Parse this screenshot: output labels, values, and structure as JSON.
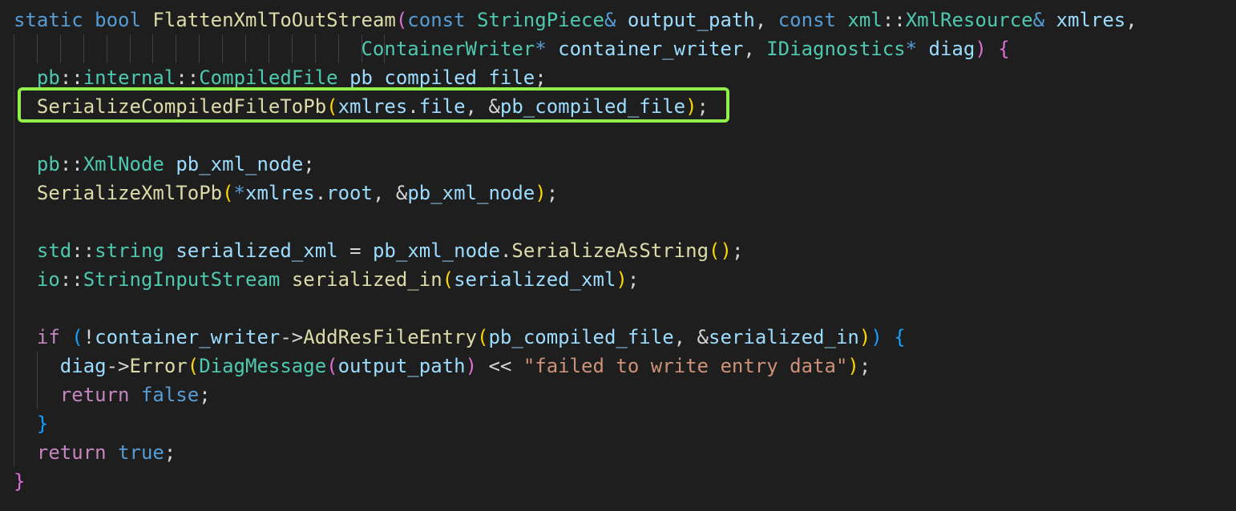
{
  "colors": {
    "background": "#1e1e1e",
    "keyword": "#569cd6",
    "function": "#dcdcaa",
    "type": "#4ec9b0",
    "variable": "#9cdcfe",
    "string": "#ce9178",
    "highlight_border": "#8ff04a"
  },
  "lines": [
    [
      {
        "t": "static",
        "c": "kw"
      },
      {
        "t": " ",
        "c": "op"
      },
      {
        "t": "bool",
        "c": "kw"
      },
      {
        "t": " ",
        "c": "op"
      },
      {
        "t": "FlattenXmlToOutStream",
        "c": "fn"
      },
      {
        "t": "(",
        "c": "b1"
      },
      {
        "t": "const",
        "c": "kw"
      },
      {
        "t": " ",
        "c": "op"
      },
      {
        "t": "StringPiece",
        "c": "ty"
      },
      {
        "t": "&",
        "c": "kw"
      },
      {
        "t": " ",
        "c": "op"
      },
      {
        "t": "output_path",
        "c": "var"
      },
      {
        "t": ", ",
        "c": "op"
      },
      {
        "t": "const",
        "c": "kw"
      },
      {
        "t": " ",
        "c": "op"
      },
      {
        "t": "xml",
        "c": "ty"
      },
      {
        "t": "::",
        "c": "op"
      },
      {
        "t": "XmlResource",
        "c": "ty"
      },
      {
        "t": "&",
        "c": "kw"
      },
      {
        "t": " ",
        "c": "op"
      },
      {
        "t": "xmlres",
        "c": "var"
      },
      {
        "t": ",",
        "c": "op"
      }
    ],
    [
      {
        "t": "                              ",
        "c": "op"
      },
      {
        "t": "ContainerWriter",
        "c": "ty"
      },
      {
        "t": "*",
        "c": "kw"
      },
      {
        "t": " ",
        "c": "op"
      },
      {
        "t": "container_writer",
        "c": "var"
      },
      {
        "t": ", ",
        "c": "op"
      },
      {
        "t": "IDiagnostics",
        "c": "ty"
      },
      {
        "t": "*",
        "c": "kw"
      },
      {
        "t": " ",
        "c": "op"
      },
      {
        "t": "diag",
        "c": "var"
      },
      {
        "t": ")",
        "c": "b1"
      },
      {
        "t": " ",
        "c": "op"
      },
      {
        "t": "{",
        "c": "b1"
      }
    ],
    [
      {
        "t": "  ",
        "c": "op"
      },
      {
        "t": "pb",
        "c": "ty"
      },
      {
        "t": "::",
        "c": "op"
      },
      {
        "t": "internal",
        "c": "ty"
      },
      {
        "t": "::",
        "c": "op"
      },
      {
        "t": "CompiledFile",
        "c": "ty"
      },
      {
        "t": " ",
        "c": "op"
      },
      {
        "t": "pb_compiled_file",
        "c": "var"
      },
      {
        "t": ";",
        "c": "op"
      }
    ],
    [
      {
        "t": "  ",
        "c": "op"
      },
      {
        "t": "SerializeCompiledFileToPb",
        "c": "fn"
      },
      {
        "t": "(",
        "c": "b2"
      },
      {
        "t": "xmlres",
        "c": "var"
      },
      {
        "t": ".",
        "c": "op"
      },
      {
        "t": "file",
        "c": "var"
      },
      {
        "t": ", &",
        "c": "op"
      },
      {
        "t": "pb_compiled_file",
        "c": "var"
      },
      {
        "t": ")",
        "c": "b2"
      },
      {
        "t": ";",
        "c": "op"
      }
    ],
    [],
    [
      {
        "t": "  ",
        "c": "op"
      },
      {
        "t": "pb",
        "c": "ty"
      },
      {
        "t": "::",
        "c": "op"
      },
      {
        "t": "XmlNode",
        "c": "ty"
      },
      {
        "t": " ",
        "c": "op"
      },
      {
        "t": "pb_xml_node",
        "c": "var"
      },
      {
        "t": ";",
        "c": "op"
      }
    ],
    [
      {
        "t": "  ",
        "c": "op"
      },
      {
        "t": "SerializeXmlToPb",
        "c": "fn"
      },
      {
        "t": "(",
        "c": "b2"
      },
      {
        "t": "*",
        "c": "kw"
      },
      {
        "t": "xmlres",
        "c": "var"
      },
      {
        "t": ".",
        "c": "op"
      },
      {
        "t": "root",
        "c": "var"
      },
      {
        "t": ", &",
        "c": "op"
      },
      {
        "t": "pb_xml_node",
        "c": "var"
      },
      {
        "t": ")",
        "c": "b2"
      },
      {
        "t": ";",
        "c": "op"
      }
    ],
    [],
    [
      {
        "t": "  ",
        "c": "op"
      },
      {
        "t": "std",
        "c": "ty"
      },
      {
        "t": "::",
        "c": "op"
      },
      {
        "t": "string",
        "c": "ty"
      },
      {
        "t": " ",
        "c": "op"
      },
      {
        "t": "serialized_xml",
        "c": "var"
      },
      {
        "t": " = ",
        "c": "op"
      },
      {
        "t": "pb_xml_node",
        "c": "var"
      },
      {
        "t": ".",
        "c": "op"
      },
      {
        "t": "SerializeAsString",
        "c": "fn"
      },
      {
        "t": "()",
        "c": "b2"
      },
      {
        "t": ";",
        "c": "op"
      }
    ],
    [
      {
        "t": "  ",
        "c": "op"
      },
      {
        "t": "io",
        "c": "ty"
      },
      {
        "t": "::",
        "c": "op"
      },
      {
        "t": "StringInputStream",
        "c": "ty"
      },
      {
        "t": " ",
        "c": "op"
      },
      {
        "t": "serialized_in",
        "c": "fn"
      },
      {
        "t": "(",
        "c": "b2"
      },
      {
        "t": "serialized_xml",
        "c": "var"
      },
      {
        "t": ")",
        "c": "b2"
      },
      {
        "t": ";",
        "c": "op"
      }
    ],
    [],
    [
      {
        "t": "  ",
        "c": "op"
      },
      {
        "t": "if",
        "c": "cf"
      },
      {
        "t": " ",
        "c": "op"
      },
      {
        "t": "(",
        "c": "b3"
      },
      {
        "t": "!",
        "c": "op"
      },
      {
        "t": "container_writer",
        "c": "var"
      },
      {
        "t": "->",
        "c": "op"
      },
      {
        "t": "AddResFileEntry",
        "c": "fn"
      },
      {
        "t": "(",
        "c": "b2"
      },
      {
        "t": "pb_compiled_file",
        "c": "var"
      },
      {
        "t": ", &",
        "c": "op"
      },
      {
        "t": "serialized_in",
        "c": "var"
      },
      {
        "t": ")",
        "c": "b2"
      },
      {
        "t": ")",
        "c": "b3"
      },
      {
        "t": " ",
        "c": "op"
      },
      {
        "t": "{",
        "c": "b3"
      }
    ],
    [
      {
        "t": "    ",
        "c": "op"
      },
      {
        "t": "diag",
        "c": "var"
      },
      {
        "t": "->",
        "c": "op"
      },
      {
        "t": "Error",
        "c": "fn"
      },
      {
        "t": "(",
        "c": "b2"
      },
      {
        "t": "DiagMessage",
        "c": "ty"
      },
      {
        "t": "(",
        "c": "b1"
      },
      {
        "t": "output_path",
        "c": "var"
      },
      {
        "t": ")",
        "c": "b1"
      },
      {
        "t": " << ",
        "c": "op"
      },
      {
        "t": "\"failed to write entry data\"",
        "c": "str"
      },
      {
        "t": ")",
        "c": "b2"
      },
      {
        "t": ";",
        "c": "op"
      }
    ],
    [
      {
        "t": "    ",
        "c": "op"
      },
      {
        "t": "return",
        "c": "cf"
      },
      {
        "t": " ",
        "c": "op"
      },
      {
        "t": "false",
        "c": "kw"
      },
      {
        "t": ";",
        "c": "op"
      }
    ],
    [
      {
        "t": "  ",
        "c": "op"
      },
      {
        "t": "}",
        "c": "b3"
      }
    ],
    [
      {
        "t": "  ",
        "c": "op"
      },
      {
        "t": "return",
        "c": "cf"
      },
      {
        "t": " ",
        "c": "op"
      },
      {
        "t": "true",
        "c": "kw"
      },
      {
        "t": ";",
        "c": "op"
      }
    ],
    [
      {
        "t": "}",
        "c": "b1"
      }
    ]
  ]
}
